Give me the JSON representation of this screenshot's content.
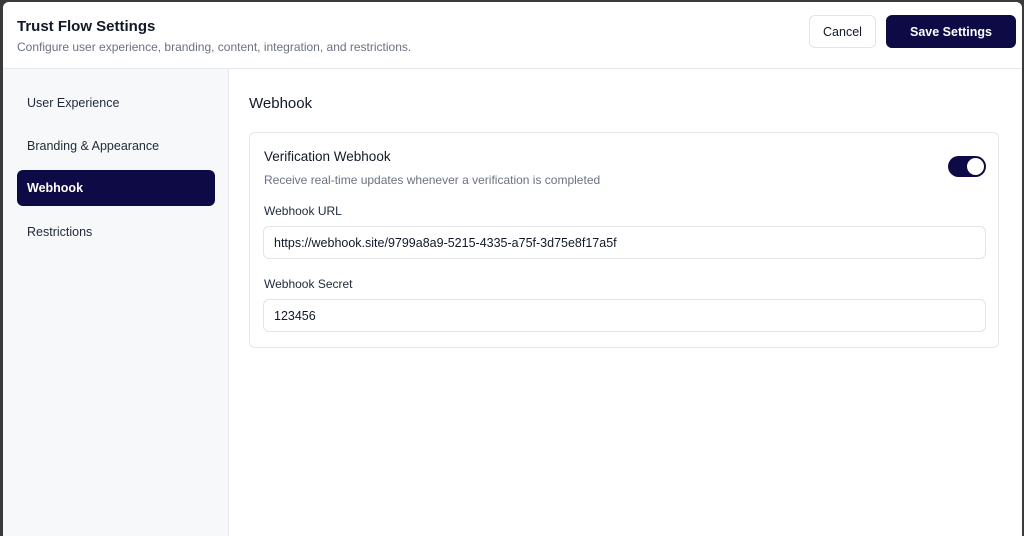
{
  "header": {
    "title": "Trust Flow Settings",
    "subtitle": "Configure user experience, branding, content, integration, and restrictions.",
    "cancel_label": "Cancel",
    "save_label": "Save Settings"
  },
  "sidebar": {
    "items": [
      {
        "label": "User Experience",
        "active": false
      },
      {
        "label": "Branding & Appearance",
        "active": false
      },
      {
        "label": "Webhook",
        "active": true
      },
      {
        "label": "Restrictions",
        "active": false
      }
    ]
  },
  "main": {
    "section_title": "Webhook",
    "card": {
      "title": "Verification Webhook",
      "description": "Receive real-time updates whenever a verification is completed",
      "toggle_on": true,
      "url_label": "Webhook URL",
      "url_value": "https://webhook.site/9799a8a9-5215-4335-a75f-3d75e8f17a5f",
      "secret_label": "Webhook Secret",
      "secret_value": "123456"
    }
  },
  "colors": {
    "accent": "#0d0a45",
    "sidebar_bg": "#f7f8fa",
    "border": "#e6e8ec"
  }
}
